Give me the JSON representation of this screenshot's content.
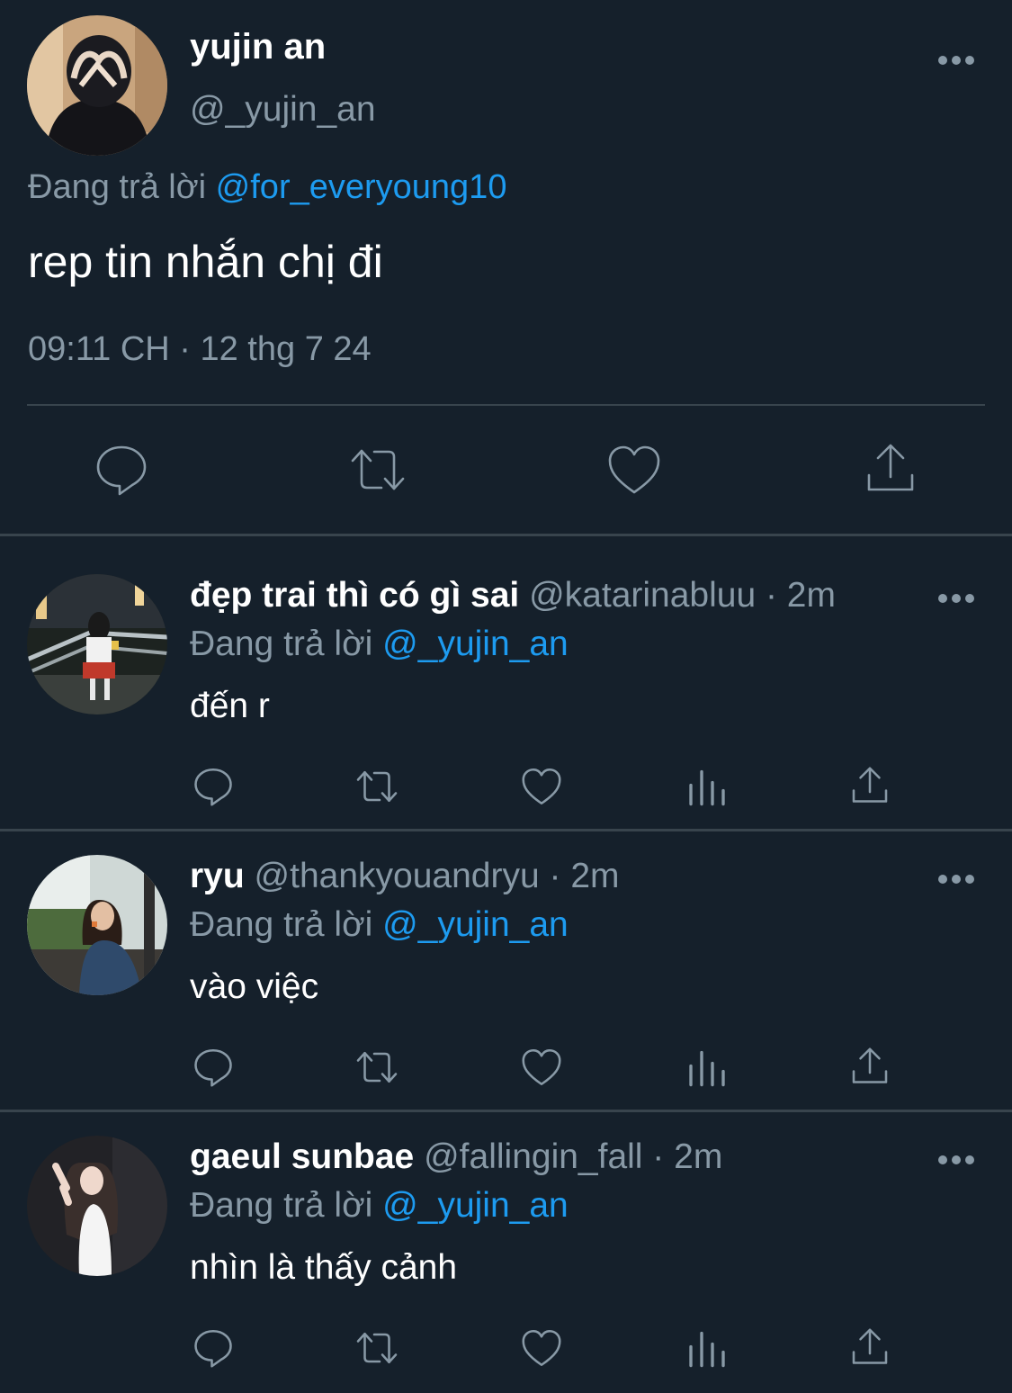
{
  "main_tweet": {
    "name": "yujin an",
    "handle": "@_yujin_an",
    "replying_prefix": "Đang trả lời",
    "replying_to": "@for_everyoung10",
    "text": "rep tin nhắn chị đi",
    "timestamp": "09:11 CH · 12 thg 7 24",
    "actions": [
      "reply-icon",
      "retweet-icon",
      "like-icon",
      "share-icon"
    ]
  },
  "replies": [
    {
      "name": "đẹp trai thì có gì sai",
      "meta": "@katarinabluu · 2m",
      "replying_prefix": "Đang trả lời",
      "replying_to": "@_yujin_an",
      "text": "đến r"
    },
    {
      "name": "ryu",
      "meta": "@thankyouandryu · 2m",
      "replying_prefix": "Đang trả lời",
      "replying_to": "@_yujin_an",
      "text": "vào việc"
    },
    {
      "name": "gaeul sunbae",
      "meta": "@fallingin_fall · 2m",
      "replying_prefix": "Đang trả lời",
      "replying_to": "@_yujin_an",
      "text": "nhìn là thấy cảnh"
    }
  ],
  "reply_actions": [
    "reply-icon",
    "retweet-icon",
    "like-icon",
    "analytics-icon",
    "share-icon"
  ],
  "colors": {
    "background": "#15202b",
    "secondary_text": "#8899a6",
    "link": "#1d9bf0",
    "divider": "#38444d"
  }
}
